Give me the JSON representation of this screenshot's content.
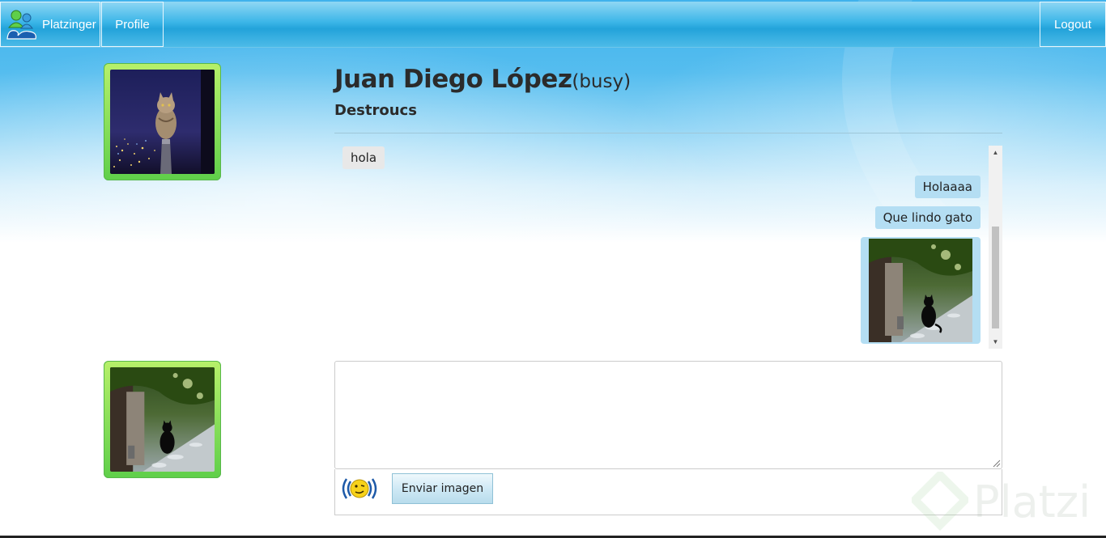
{
  "navbar": {
    "brand_label": "Platzinger",
    "profile_label": "Profile",
    "logout_label": "Logout"
  },
  "friend": {
    "name": "Juan Diego López",
    "status": "(busy)",
    "nick": "Destroucs"
  },
  "conversation": {
    "messages": [
      {
        "direction": "incoming",
        "type": "text",
        "text": "hola"
      },
      {
        "direction": "outgoing",
        "type": "text",
        "text": "Holaaaa"
      },
      {
        "direction": "outgoing",
        "type": "text",
        "text": "Que lindo gato"
      },
      {
        "direction": "outgoing",
        "type": "image"
      }
    ]
  },
  "composer": {
    "value": "",
    "buzz_icon": "buzz-smiley-icon",
    "send_image_label": "Enviar imagen"
  },
  "watermark": {
    "text": "Platzi"
  },
  "colors": {
    "navbar": "#23a3da",
    "avatar_frame": "#5fcf4a",
    "outgoing_bubble": "#b4def3",
    "incoming_bubble": "#e8e8e8"
  }
}
